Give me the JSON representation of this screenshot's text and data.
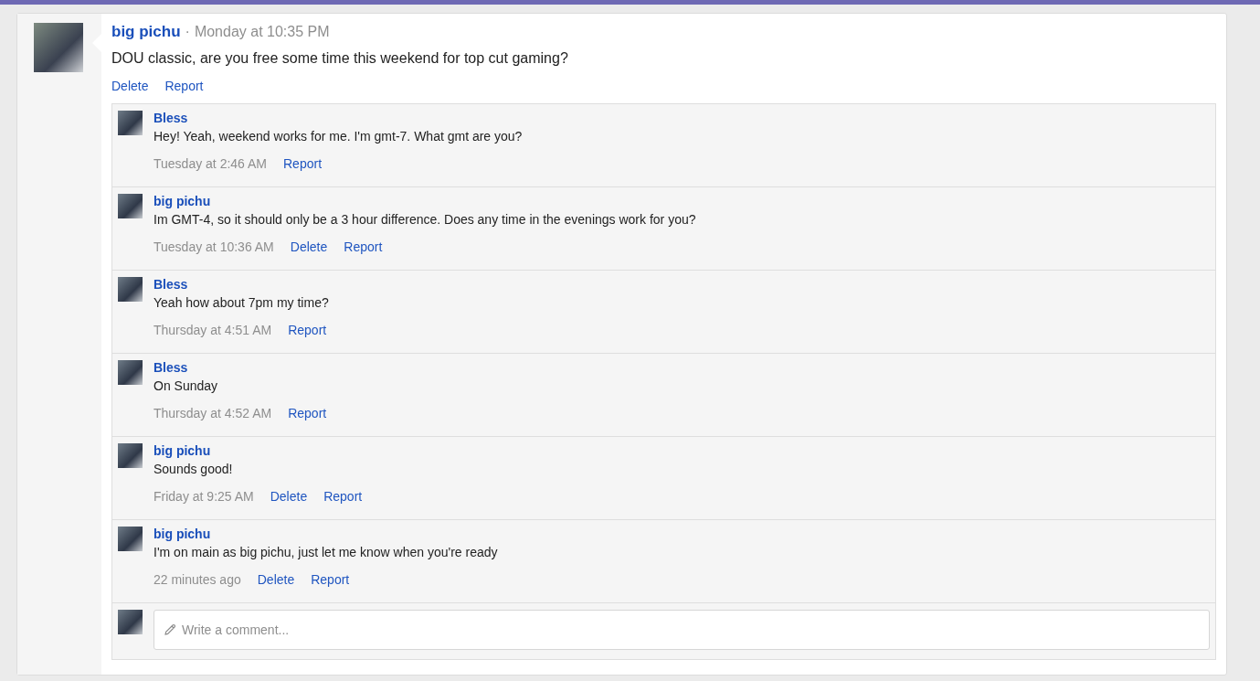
{
  "post": {
    "author": "big pichu",
    "separator": "·",
    "time": "Monday at 10:35 PM",
    "message": "DOU classic, are you free some time this weekend for top cut gaming?",
    "actions": [
      "Delete",
      "Report"
    ]
  },
  "comments": [
    {
      "author": "Bless",
      "message": "Hey! Yeah, weekend works for me. I'm gmt-7. What gmt are you?",
      "time": "Tuesday at 2:46 AM",
      "actions": [
        "Report"
      ]
    },
    {
      "author": "big pichu",
      "message": "Im GMT-4, so it should only be a 3 hour difference. Does any time in the evenings work for you?",
      "time": "Tuesday at 10:36 AM",
      "actions": [
        "Delete",
        "Report"
      ]
    },
    {
      "author": "Bless",
      "message": "Yeah how about 7pm my time?",
      "time": "Thursday at 4:51 AM",
      "actions": [
        "Report"
      ]
    },
    {
      "author": "Bless",
      "message": "On Sunday",
      "time": "Thursday at 4:52 AM",
      "actions": [
        "Report"
      ]
    },
    {
      "author": "big pichu",
      "message": "Sounds good!",
      "time": "Friday at 9:25 AM",
      "actions": [
        "Delete",
        "Report"
      ]
    },
    {
      "author": "big pichu",
      "message": "I'm on main as big pichu, just let me know when you're ready",
      "time": "22 minutes ago",
      "actions": [
        "Delete",
        "Report"
      ]
    }
  ],
  "comment_box": {
    "placeholder": "Write a comment..."
  }
}
